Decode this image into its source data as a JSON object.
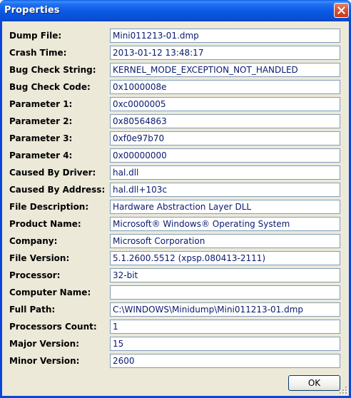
{
  "window": {
    "title": "Properties"
  },
  "properties": [
    {
      "label": "Dump File:",
      "value": "Mini011213-01.dmp"
    },
    {
      "label": "Crash Time:",
      "value": "2013-01-12 13:48:17"
    },
    {
      "label": "Bug Check String:",
      "value": "KERNEL_MODE_EXCEPTION_NOT_HANDLED"
    },
    {
      "label": "Bug Check Code:",
      "value": "0x1000008e"
    },
    {
      "label": "Parameter 1:",
      "value": "0xc0000005"
    },
    {
      "label": "Parameter 2:",
      "value": "0x80564863"
    },
    {
      "label": "Parameter 3:",
      "value": "0xf0e97b70"
    },
    {
      "label": "Parameter 4:",
      "value": "0x00000000"
    },
    {
      "label": "Caused By Driver:",
      "value": "hal.dll"
    },
    {
      "label": "Caused By Address:",
      "value": "hal.dll+103c"
    },
    {
      "label": "File Description:",
      "value": "Hardware Abstraction Layer DLL"
    },
    {
      "label": "Product Name:",
      "value": "Microsoft® Windows® Operating System"
    },
    {
      "label": "Company:",
      "value": "Microsoft Corporation"
    },
    {
      "label": "File Version:",
      "value": "5.1.2600.5512 (xpsp.080413-2111)"
    },
    {
      "label": "Processor:",
      "value": "32-bit"
    },
    {
      "label": "Computer Name:",
      "value": ""
    },
    {
      "label": "Full Path:",
      "value": "C:\\WINDOWS\\Minidump\\Mini011213-01.dmp"
    },
    {
      "label": "Processors Count:",
      "value": "1"
    },
    {
      "label": "Major Version:",
      "value": "15"
    },
    {
      "label": "Minor Version:",
      "value": "2600"
    }
  ],
  "buttons": {
    "ok_label": "OK"
  },
  "icons": {
    "close": "close-icon",
    "grip": "resize-grip-icon"
  },
  "colors": {
    "titlebar": "#0a58e3",
    "client_bg": "#ece9d8",
    "field_text": "#0a1a6e",
    "field_border": "#7f9db9"
  }
}
